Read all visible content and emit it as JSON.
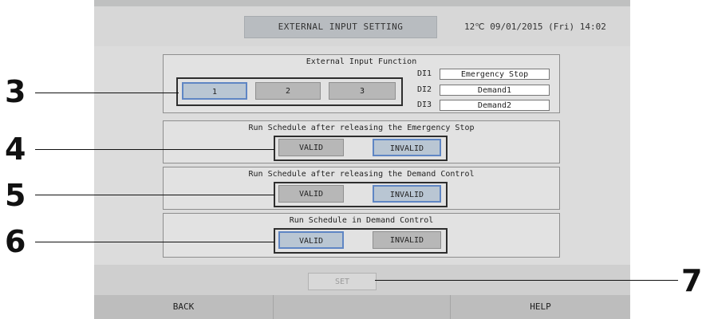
{
  "header": {
    "title": "EXTERNAL INPUT SETTING",
    "status": "12℃  09/01/2015 (Fri) 14:02"
  },
  "external_input": {
    "title": "External Input Function",
    "buttons": [
      "1",
      "2",
      "3"
    ],
    "selected": "1",
    "inputs": [
      {
        "label": "DI1",
        "value": "Emergency Stop"
      },
      {
        "label": "DI2",
        "value": "Demand1"
      },
      {
        "label": "DI3",
        "value": "Demand2"
      }
    ]
  },
  "emergency_stop": {
    "title": "Run Schedule after releasing the Emergency Stop",
    "valid": "VALID",
    "invalid": "INVALID",
    "selected": "INVALID"
  },
  "demand_release": {
    "title": "Run Schedule after releasing the Demand Control",
    "valid": "VALID",
    "invalid": "INVALID",
    "selected": "INVALID"
  },
  "demand_control": {
    "title": "Run Schedule in Demand Control",
    "valid": "VALID",
    "invalid": "INVALID",
    "selected": "VALID"
  },
  "set_button": "SET",
  "footer": {
    "back": "BACK",
    "help": "HELP"
  },
  "callouts": [
    "3",
    "4",
    "5",
    "6",
    "7"
  ]
}
